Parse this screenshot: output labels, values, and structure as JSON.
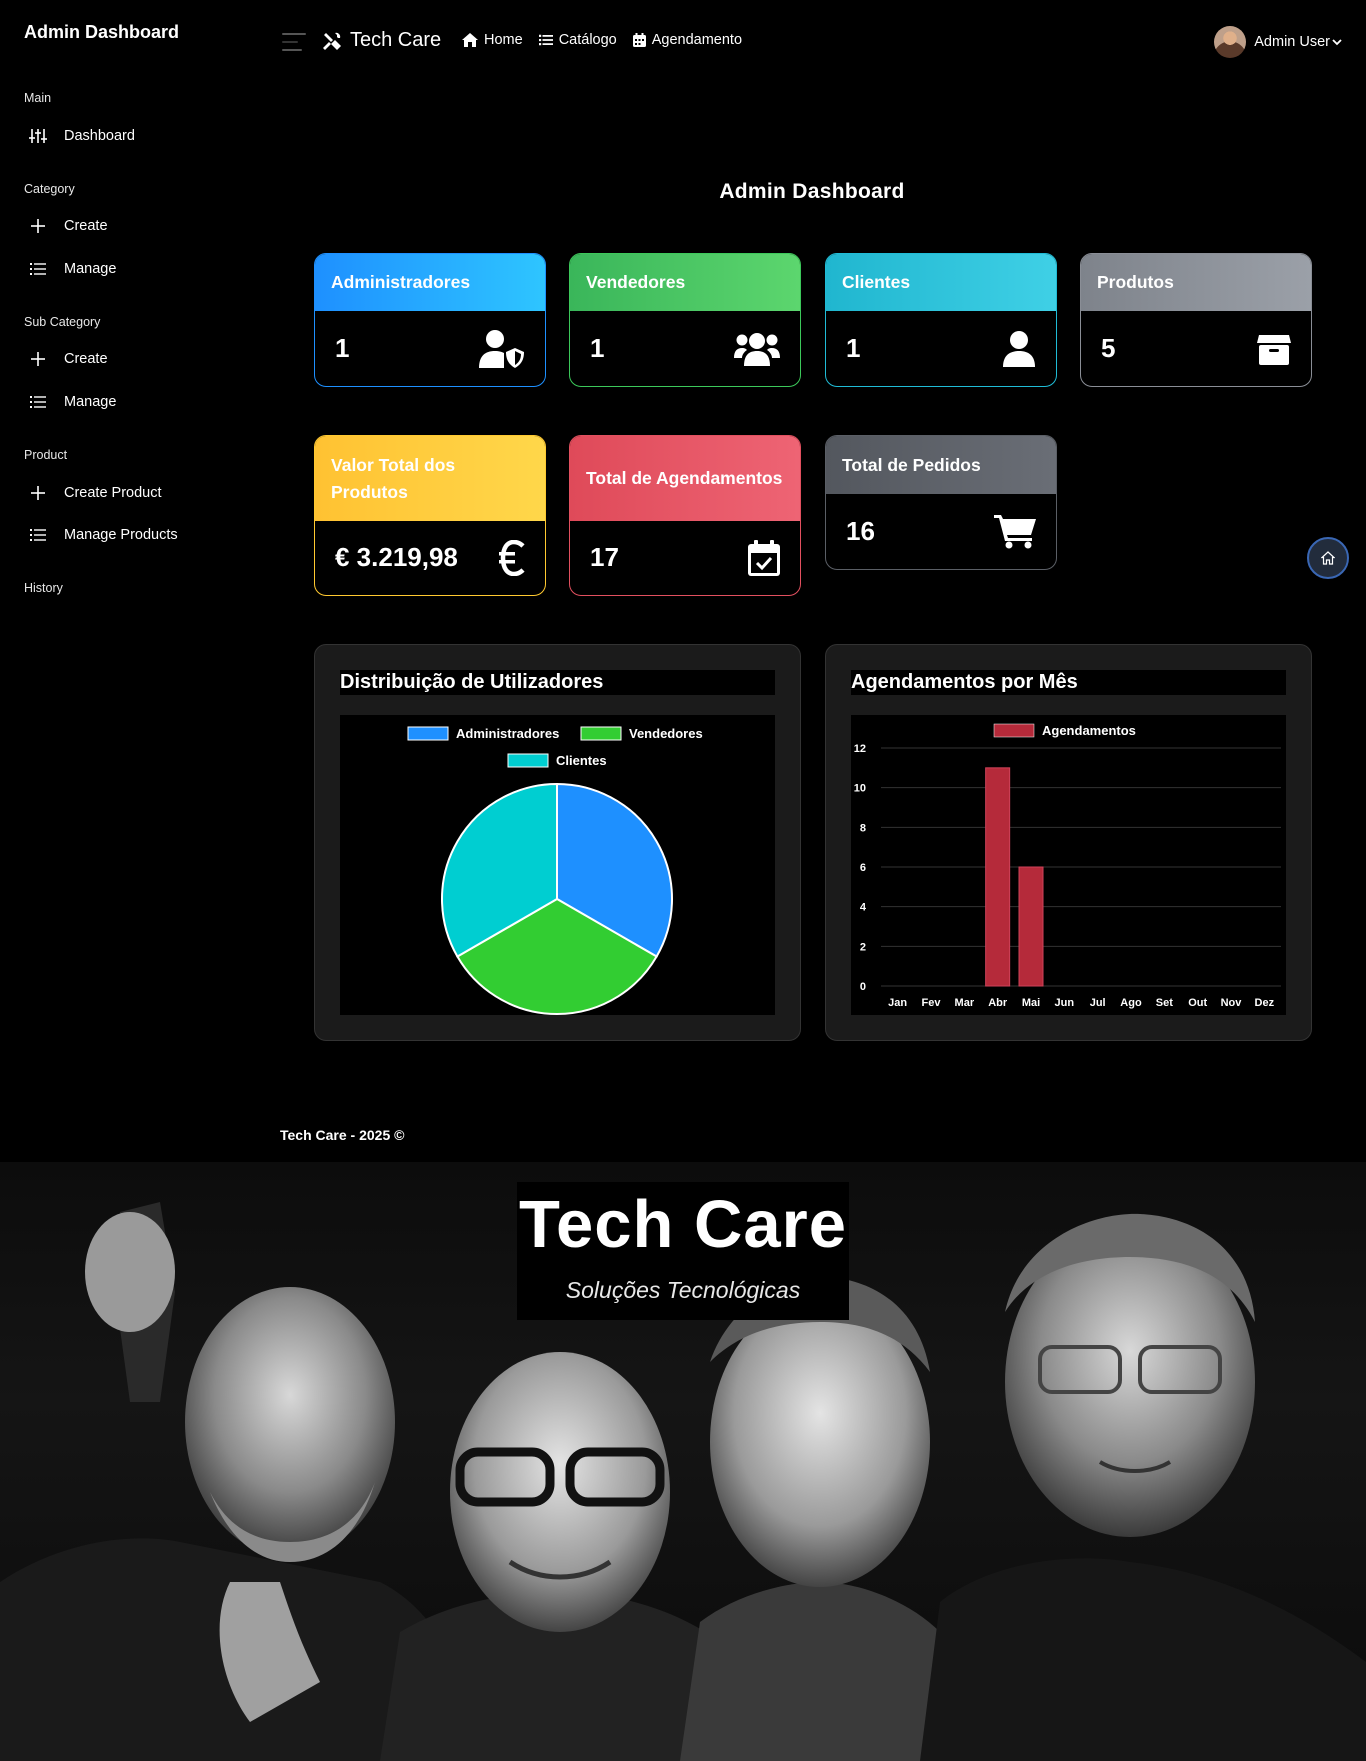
{
  "sidebar": {
    "brand": "Admin Dashboard",
    "sections": [
      {
        "label": "Main",
        "items": [
          {
            "label": "Dashboard",
            "icon": "sliders-icon"
          }
        ]
      },
      {
        "label": "Category",
        "items": [
          {
            "label": "Create",
            "icon": "plus-icon"
          },
          {
            "label": "Manage",
            "icon": "list-icon"
          }
        ]
      },
      {
        "label": "Sub Category",
        "items": [
          {
            "label": "Create",
            "icon": "plus-icon"
          },
          {
            "label": "Manage",
            "icon": "list-icon"
          }
        ]
      },
      {
        "label": "Product",
        "items": [
          {
            "label": "Create Product",
            "icon": "plus-icon"
          },
          {
            "label": "Manage Products",
            "icon": "list-icon"
          }
        ]
      },
      {
        "label": "History",
        "items": []
      }
    ]
  },
  "topbar": {
    "brand": "Tech Care",
    "links": [
      {
        "label": "Home",
        "icon": "home-icon"
      },
      {
        "label": "Catálogo",
        "icon": "list-icon"
      },
      {
        "label": "Agendamento",
        "icon": "calendar-icon"
      }
    ],
    "user": "Admin User"
  },
  "main": {
    "title": "Admin Dashboard",
    "cards": [
      {
        "label": "Administradores",
        "value": "1",
        "color": "#1e90ff",
        "icon": "user-shield-icon"
      },
      {
        "label": "Vendedores",
        "value": "1",
        "color": "#3cc85a",
        "icon": "users-icon"
      },
      {
        "label": "Clientes",
        "value": "1",
        "color": "#20bcd6",
        "icon": "user-icon"
      },
      {
        "label": "Produtos",
        "value": "5",
        "color": "#8a8e96",
        "icon": "box-icon"
      },
      {
        "label": "Valor Total dos Produtos",
        "value": "€ 3.219,98",
        "color": "#ffc930",
        "icon": "euro-icon"
      },
      {
        "label": "Total de Agendamentos",
        "value": "17",
        "color": "#e2505f",
        "icon": "calendar-check-icon"
      },
      {
        "label": "Total de Pedidos",
        "value": "16",
        "color": "#5b5f66",
        "icon": "cart-icon"
      }
    ],
    "pie_title": "Distribuição de Utilizadores",
    "bar_title": "Agendamentos por Mês"
  },
  "chart_data": [
    {
      "type": "pie",
      "title": "Distribuição de Utilizadores",
      "categories": [
        "Administradores",
        "Vendedores",
        "Clientes"
      ],
      "values": [
        1,
        1,
        1
      ],
      "colors": [
        "#1e90ff",
        "#32cd32",
        "#00ced1"
      ],
      "legend": "top"
    },
    {
      "type": "bar",
      "title": "Agendamentos por Mês",
      "categories": [
        "Jan",
        "Fev",
        "Mar",
        "Abr",
        "Mai",
        "Jun",
        "Jul",
        "Ago",
        "Set",
        "Out",
        "Nov",
        "Dez"
      ],
      "series": [
        {
          "name": "Agendamentos",
          "values": [
            0,
            0,
            0,
            11,
            6,
            0,
            0,
            0,
            0,
            0,
            0,
            0
          ]
        }
      ],
      "color": "#b52a3a",
      "ylim": [
        0,
        12
      ],
      "yticks": [
        0,
        2,
        4,
        6,
        8,
        10,
        12
      ],
      "grid": true,
      "legend": "top"
    }
  ],
  "footer": {
    "text": "Tech Care - 2025 ©"
  },
  "hero": {
    "title": "Tech Care",
    "subtitle": "Soluções Tecnológicas"
  }
}
